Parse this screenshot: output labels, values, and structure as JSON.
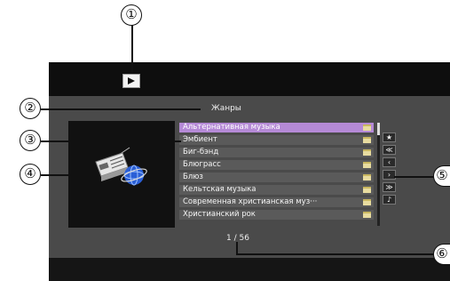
{
  "title": "Жанры",
  "genres": [
    "Альтернативная музыка",
    "Эмбиент",
    "Биг-бэнд",
    "Блюграсс",
    "Блюз",
    "Кельтская музыка",
    "Современная христианская муз···",
    "Христианский рок"
  ],
  "selected_index": 0,
  "side_buttons": [
    "★",
    "≪",
    "‹",
    "›",
    "≫",
    "♪"
  ],
  "pagination": "1 / 56",
  "callouts": [
    "①",
    "②",
    "③",
    "④",
    "⑤",
    "⑥"
  ],
  "colors": {
    "highlight": "#b58ad6",
    "panel": "#4a4a4a"
  },
  "icons": {
    "play": "play-icon",
    "folder": "folder-icon",
    "device": "radio-globe-icon"
  }
}
